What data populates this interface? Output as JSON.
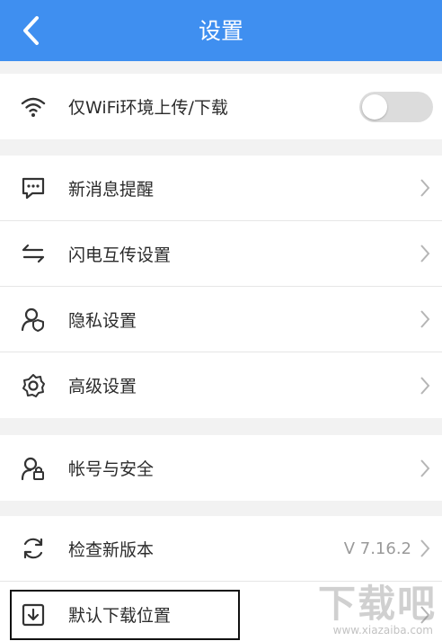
{
  "header": {
    "title": "设置",
    "back_icon": "chevron-left-icon",
    "bg_color": "#3f8ff0"
  },
  "groups": [
    {
      "items": [
        {
          "label": "仅WiFi环境上传/下载",
          "icon": "wifi-icon",
          "toggle_on": false
        }
      ]
    },
    {
      "items": [
        {
          "label": "新消息提醒",
          "icon": "message-icon"
        },
        {
          "label": "闪电互传设置",
          "icon": "transfer-arrows-icon"
        },
        {
          "label": "隐私设置",
          "icon": "privacy-user-icon"
        },
        {
          "label": "高级设置",
          "icon": "gear-icon"
        }
      ]
    },
    {
      "items": [
        {
          "label": "帐号与安全",
          "icon": "user-lock-icon"
        }
      ]
    },
    {
      "items": [
        {
          "label": "检查新版本",
          "icon": "refresh-icon",
          "value": "V 7.16.2"
        },
        {
          "label": "默认下载位置",
          "icon": "download-box-icon"
        }
      ]
    }
  ],
  "watermark": {
    "main": "下载吧",
    "sub": "www.xiazaiba.com"
  }
}
